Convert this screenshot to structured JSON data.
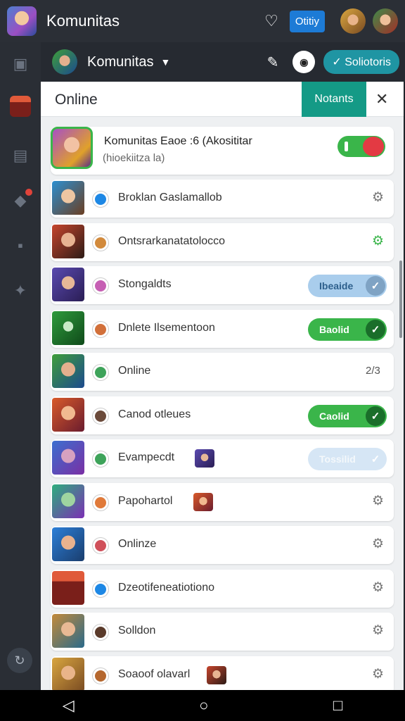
{
  "topbar": {
    "title": "Komunitas",
    "button_label": "Otitiy"
  },
  "channel": {
    "title": "Komunitas",
    "status_button": "Soliotoris"
  },
  "panel": {
    "title": "Online",
    "tab": "Notants",
    "featured": {
      "title": "Komunitas Eaoe :6 (Akosititar",
      "subtitle": "(hioekiitza la)",
      "enabled": true
    },
    "members": [
      {
        "name": "Broklan Gaslamallob",
        "status_color": "#1e88e5",
        "trailing": "gear"
      },
      {
        "name": "Ontsrarkanatatolocco",
        "status_color": "#d28a3c",
        "trailing": "gear-green"
      },
      {
        "name": "Stongaldts",
        "status_color": "#c65fb3",
        "trailing": "toggle",
        "toggle_label": "Ibeaide",
        "toggle_style": "blue"
      },
      {
        "name": "Dnlete Ilsementoon",
        "status_color": "#d2703a",
        "trailing": "toggle",
        "toggle_label": "Baolid",
        "toggle_style": "green"
      },
      {
        "name": "Online",
        "status_color": "#3ea35a",
        "trailing": "number",
        "number": "2/3"
      },
      {
        "name": "Canod otleues",
        "status_color": "#6b4a3a",
        "trailing": "toggle",
        "toggle_label": "Caolid",
        "toggle_style": "green"
      },
      {
        "name": "Evampecdt",
        "status_color": "#3ea35a",
        "trailing": "toggle-pale",
        "toggle_label": "Tossilid"
      },
      {
        "name": "Papohartol",
        "status_color": "#e07a3a",
        "trailing": "gear"
      },
      {
        "name": "Onlinze",
        "status_color": "#d0505a",
        "trailing": "gear"
      },
      {
        "name": "Dzeotifeneatiotiono",
        "status_color": "#1e88e5",
        "trailing": "gear"
      },
      {
        "name": "Solldon",
        "status_color": "#5a3a2a",
        "trailing": "gear"
      },
      {
        "name": "Soaoof olavarl",
        "status_color": "#b5672e",
        "trailing": "gear"
      }
    ]
  },
  "icons": {
    "heart": "heart-icon",
    "settings": "gear-icon",
    "check": "check-icon",
    "back": "back-icon",
    "home": "home-icon",
    "recents": "recents-icon"
  },
  "colors": {
    "accent_teal": "#149a86",
    "toggle_green": "#3ab54a",
    "toggle_red": "#e33a43",
    "blue_button": "#1d7bd6"
  }
}
